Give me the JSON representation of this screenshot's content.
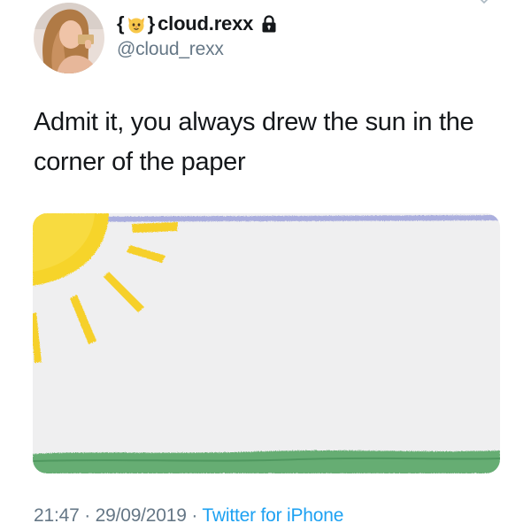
{
  "user": {
    "brace_open": "{",
    "brace_close": "}",
    "emoji": "cat-face-icon",
    "display_name": "cloud.rexx",
    "protected_icon": "lock-icon",
    "handle": "@cloud_rexx"
  },
  "tweet": {
    "text": "Admit it, you always drew the sun in the corner of the paper"
  },
  "meta": {
    "time": "21:47",
    "separator": " · ",
    "date": "29/09/2019",
    "separator2": " · ",
    "source": "Twitter for iPhone"
  },
  "colors": {
    "text": "#14171a",
    "secondary": "#657786",
    "link": "#1da1f2",
    "sun": "#f7d42c",
    "grass": "#5fa86a",
    "sky": "#8a8fd6"
  }
}
